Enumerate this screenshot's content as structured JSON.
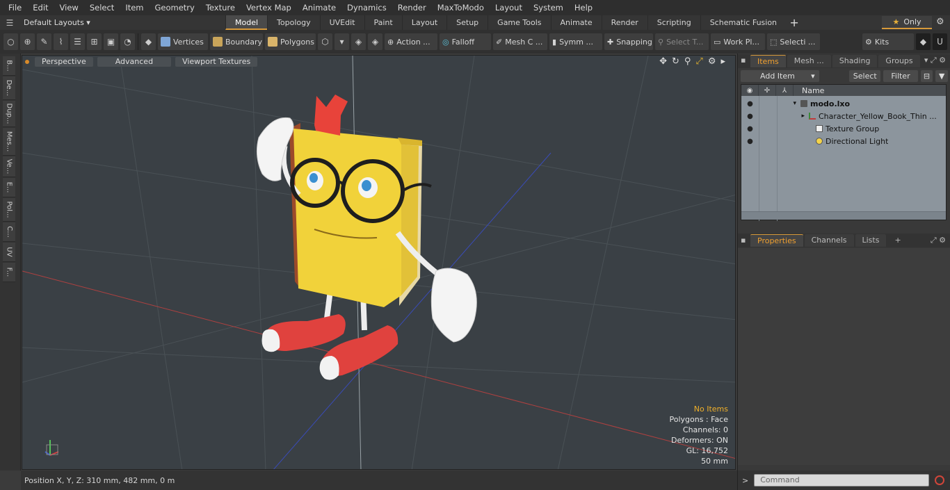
{
  "menubar": {
    "items": [
      "File",
      "Edit",
      "View",
      "Select",
      "Item",
      "Geometry",
      "Texture",
      "Vertex Map",
      "Animate",
      "Dynamics",
      "Render",
      "MaxToModo",
      "Layout",
      "System",
      "Help"
    ]
  },
  "layoutbar": {
    "layout_select": "Default Layouts ▾",
    "tabs": [
      "Model",
      "Topology",
      "UVEdit",
      "Paint",
      "Layout",
      "Setup",
      "Game Tools",
      "Animate",
      "Render",
      "Scripting",
      "Schematic Fusion"
    ],
    "active_tab": "Model",
    "add_tab": "+",
    "only_label": "Only"
  },
  "toolbar": {
    "vertices": "Vertices",
    "boundary": "Boundary",
    "polygons": "Polygons",
    "action": "Action ...",
    "falloff": "Falloff",
    "mesh_c": "Mesh C ...",
    "symm": "Symm ...",
    "snapping": "Snapping",
    "select_t": "Select T...",
    "work_pl": "Work Pl...",
    "selecti": "Selecti ...",
    "kits": "Kits"
  },
  "lefttabs": [
    "B...",
    "De...",
    "Dup...",
    "Mes...",
    "Ve...",
    "E...",
    "Pol...",
    "C...",
    "UV",
    "F..."
  ],
  "viewport": {
    "perspective": "Perspective",
    "advanced": "Advanced",
    "viewport_textures": "Viewport Textures",
    "info": {
      "no_items": "No Items",
      "polygons": "Polygons : Face",
      "channels": "Channels: 0",
      "deformers": "Deformers: ON",
      "gl": "GL: 16,752",
      "scale": "50 mm"
    }
  },
  "statusbar": {
    "position": "Position X, Y, Z:  310 mm, 482 mm, 0 m"
  },
  "items_panel": {
    "tabs": [
      "Items",
      "Mesh ...",
      "Shading",
      "Groups"
    ],
    "active_tab": "Items",
    "add_item": "Add Item",
    "select": "Select",
    "filter": "Filter",
    "name_header": "Name",
    "tree": [
      {
        "label": "modo.lxo",
        "bold": true
      },
      {
        "label": "Character_Yellow_Book_Thin ..."
      },
      {
        "label": "Texture Group"
      },
      {
        "label": "Directional Light"
      }
    ]
  },
  "props_panel": {
    "tabs": [
      "Properties",
      "Channels",
      "Lists"
    ],
    "active_tab": "Properties",
    "add_tab": "+"
  },
  "command": {
    "placeholder": "Command",
    "prompt": ">"
  },
  "colors": {
    "accent": "#d89a3a",
    "viewport_bg": "#3a4045",
    "tree_bg": "#8c959d",
    "book_yellow": "#f1d23a",
    "shoe_red": "#e0423e"
  }
}
